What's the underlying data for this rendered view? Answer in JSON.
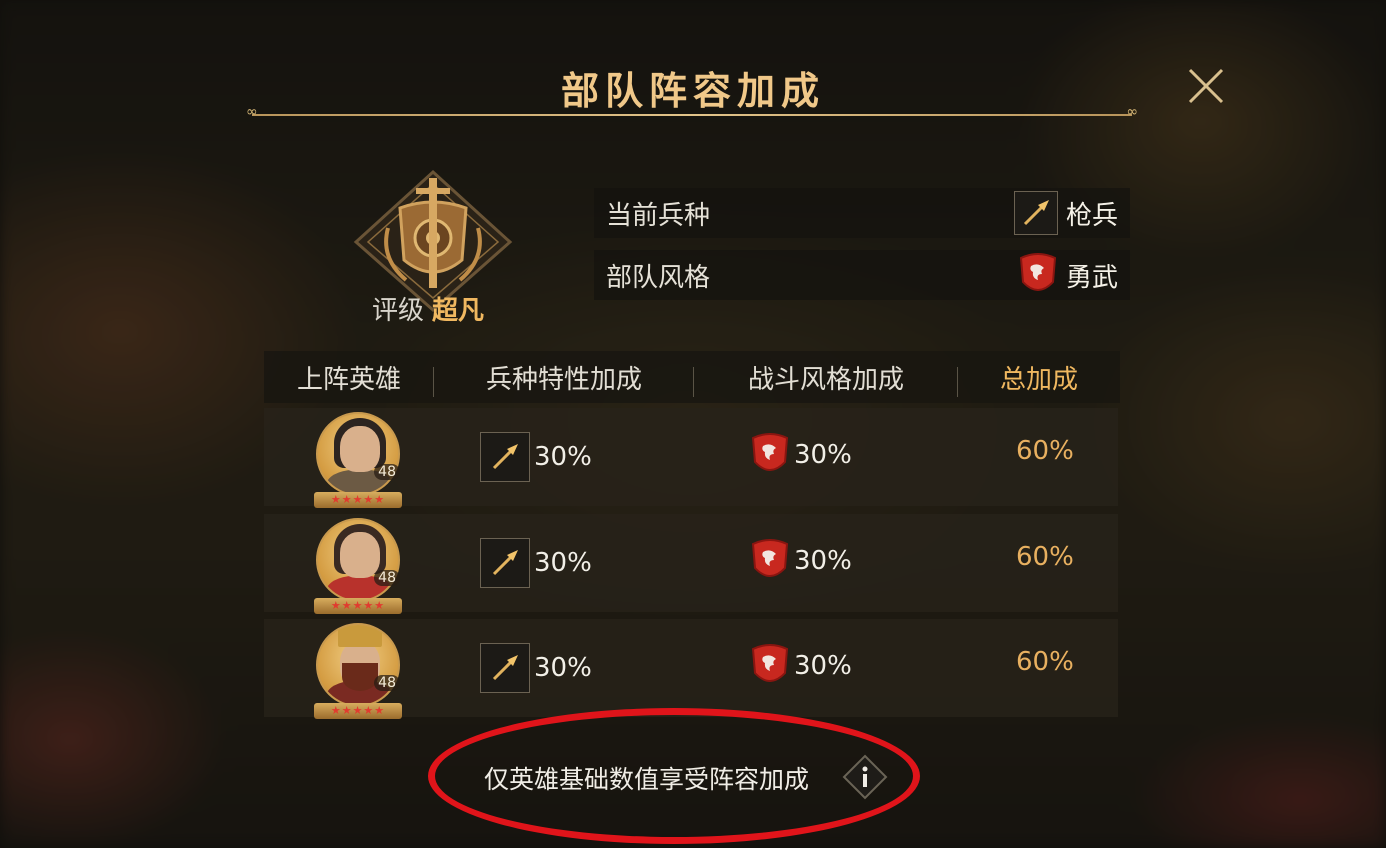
{
  "dialog": {
    "title": "部队阵容加成",
    "rank_label": "评级",
    "rank_value": "超凡"
  },
  "info": {
    "troop_type_label": "当前兵种",
    "troop_type_value": "枪兵",
    "troop_style_label": "部队风格",
    "troop_style_value": "勇武"
  },
  "table": {
    "headers": [
      "上阵英雄",
      "兵种特性加成",
      "战斗风格加成",
      "总加成"
    ],
    "rows": [
      {
        "level": "48",
        "trait_bonus": "30%",
        "style_bonus": "30%",
        "total": "60%",
        "stars": "★★★★★"
      },
      {
        "level": "48",
        "trait_bonus": "30%",
        "style_bonus": "30%",
        "total": "60%",
        "stars": "★★★★★"
      },
      {
        "level": "48",
        "trait_bonus": "30%",
        "style_bonus": "30%",
        "total": "60%",
        "stars": "★★★★★"
      }
    ]
  },
  "footer": {
    "note": "仅英雄基础数值享受阵容加成",
    "info_icon": "i"
  },
  "colors": {
    "gold": "#f0c889",
    "accent": "#f0b860",
    "highlight_ring": "#e0141a"
  },
  "icons": {
    "close": "close-icon",
    "spear": "spear-icon",
    "style": "lion-shield-icon",
    "info": "info-icon"
  }
}
